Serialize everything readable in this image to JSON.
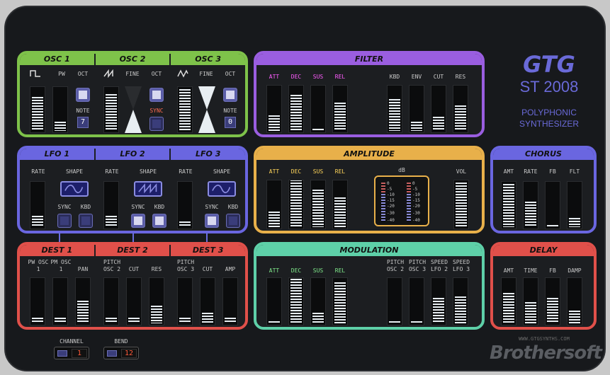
{
  "brand": {
    "name": "GTG",
    "model": "ST 2008",
    "line1": "POLYPHONIC",
    "line2": "SYNTHESIZER"
  },
  "osc": {
    "tabs": [
      "OSC 1",
      "OSC 2",
      "OSC 3"
    ],
    "labels": [
      "PW",
      "OCT",
      "NOTE",
      "FINE",
      "OCT",
      "SYNC",
      "FINE",
      "OCT",
      "NOTE"
    ],
    "note1": "7",
    "note3": "0",
    "levels": [
      0.75,
      0.2,
      0.82,
      0.92,
      0.9
    ]
  },
  "filter": {
    "title": "FILTER",
    "labels": [
      "ATT",
      "DEC",
      "SUS",
      "REL",
      "KBD",
      "ENV",
      "CUT",
      "RES"
    ],
    "levels": [
      0.33,
      0.78,
      0.05,
      0.6,
      0.68,
      0.2,
      0.3,
      0.55
    ]
  },
  "lfo": {
    "tabs": [
      "LFO 1",
      "LFO 2",
      "LFO 3"
    ],
    "labels": [
      "RATE",
      "SHAPE",
      "SYNC",
      "KBD",
      "RATE",
      "SHAPE",
      "SYNC",
      "KBD",
      "RATE",
      "SHAPE",
      "SYNC",
      "KBD"
    ],
    "levels": [
      0.25,
      0.25,
      0.12
    ]
  },
  "amplitude": {
    "title": "AMPLITUDE",
    "labels": [
      "ATT",
      "DEC",
      "SUS",
      "REL",
      "VOL"
    ],
    "db_label": "dB",
    "db_marks": [
      "0",
      "-5",
      "-10",
      "-15",
      "-20",
      "-30",
      "-40"
    ],
    "levels": [
      0.33,
      0.98,
      0.78,
      0.62,
      0.92
    ]
  },
  "chorus": {
    "title": "CHORUS",
    "labels": [
      "AMT",
      "RATE",
      "FB",
      "FLT"
    ],
    "levels": [
      0.92,
      0.55,
      0.05,
      0.2
    ]
  },
  "dest": {
    "tabs": [
      "DEST 1",
      "DEST 2",
      "DEST 3"
    ],
    "labels": [
      "PW OSC 1",
      "PM OSC 1",
      "PAN",
      "PITCH OSC 2",
      "CUT",
      "RES",
      "PITCH OSC 3",
      "CUT",
      "AMP"
    ],
    "levels": [
      0.12,
      0.12,
      0.48,
      0.12,
      0.12,
      0.38,
      0.12,
      0.22,
      0.12
    ]
  },
  "modulation": {
    "title": "MODULATION",
    "labels": [
      "ATT",
      "DEC",
      "SUS",
      "REL",
      "PITCH OSC 2",
      "PITCH OSC 3",
      "SPEED LFO 2",
      "SPEED LFO 3"
    ],
    "levels": [
      0.05,
      0.95,
      0.22,
      0.88,
      0.05,
      0.05,
      0.55,
      0.58
    ]
  },
  "delay": {
    "title": "DELAY",
    "labels": [
      "AMT",
      "TIME",
      "FB",
      "DAMP"
    ],
    "levels": [
      0.65,
      0.45,
      0.55,
      0.28
    ]
  },
  "footer": {
    "channel_label": "CHANNEL",
    "channel_value": "1",
    "bend_label": "BEND",
    "bend_value": "12",
    "url": "WWW.GTGSYNTHS.COM",
    "watermark": "Brothersoft"
  },
  "colors": {
    "osc": "#7ec24a",
    "filter": "#9a5ee0",
    "lfo": "#6a66e0",
    "amplitude": "#e8b04a",
    "chorus": "#6a66e0",
    "dest": "#e0504a",
    "modulation": "#5ed0a8",
    "delay": "#e0504a"
  }
}
